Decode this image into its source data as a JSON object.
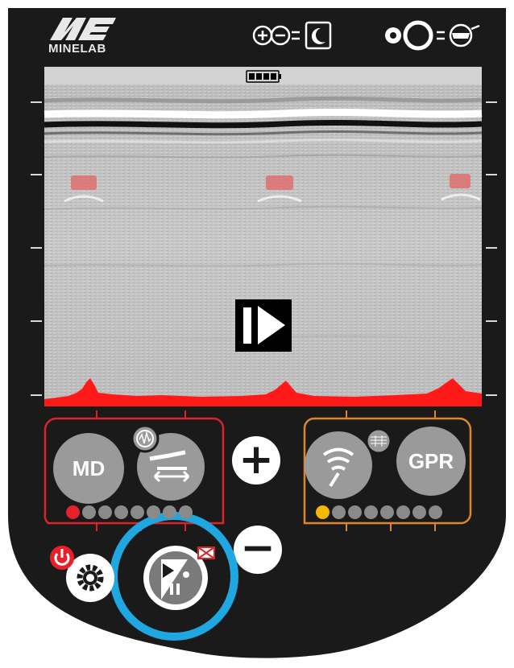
{
  "brand": {
    "name": "MINELAB"
  },
  "status": {
    "battery_icon": "battery-full-icon"
  },
  "top_controls": {
    "brightness": {
      "equals": "=",
      "icon": "night-mode-icon"
    },
    "stealth": {
      "equals": "=",
      "icon": "stealth-mask-icon"
    }
  },
  "left_panel": {
    "md_label": "MD",
    "active_dot_color": "#e8202a",
    "dot_count": 8
  },
  "right_panel": {
    "gpr_label": "GPR",
    "active_dot_color": "#f5b800",
    "dot_count": 8
  },
  "center": {
    "plus_label": "+",
    "minus_label": "−"
  },
  "colors": {
    "body": "#1a1a1a",
    "left_frame": "#d8242a",
    "right_frame": "#e0862a",
    "highlight_ring": "#1ea7e1",
    "power": "#e8202a",
    "signal": "#ff1a1a"
  }
}
